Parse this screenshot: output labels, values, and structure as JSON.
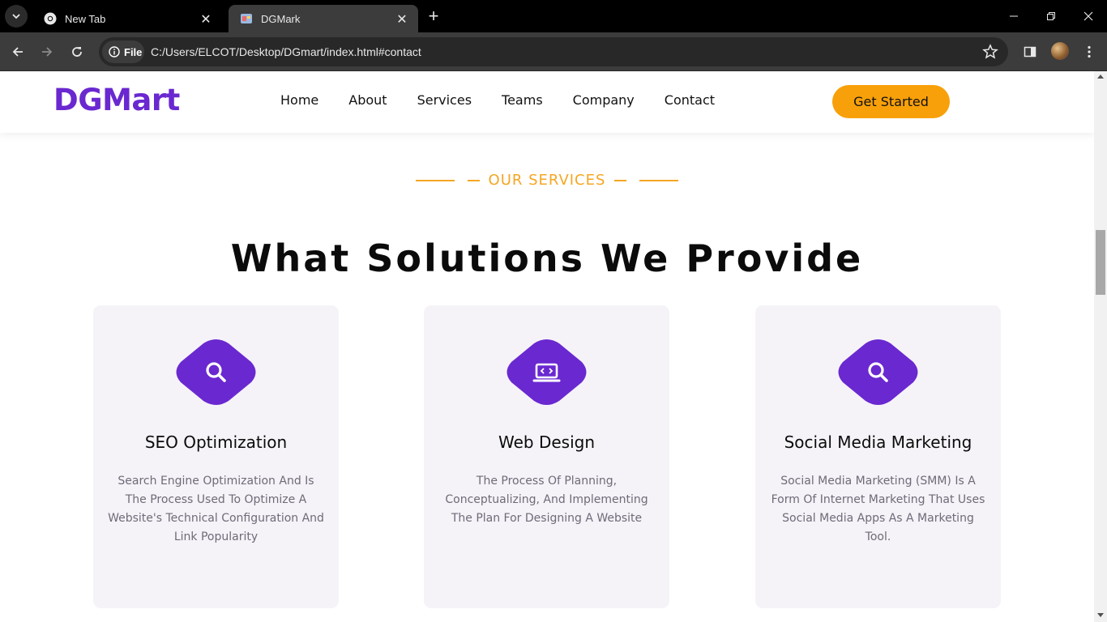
{
  "browser": {
    "tabs": [
      {
        "title": "New Tab",
        "icon": "chrome-icon",
        "active": false
      },
      {
        "title": "DGMark",
        "icon": "page-favicon",
        "active": true
      }
    ],
    "chip_label": "File",
    "url": "C:/Users/ELCOT/Desktop/DGmart/index.html#contact"
  },
  "site": {
    "logo": "DGMart",
    "nav": [
      "Home",
      "About",
      "Services",
      "Teams",
      "Company",
      "Contact"
    ],
    "cta": "Get Started"
  },
  "section": {
    "eyebrow": "OUR SERVICES",
    "heading": "What Solutions We Provide",
    "cards": [
      {
        "icon": "search-icon",
        "title": "SEO Optimization",
        "description": "Search Engine Optimization And Is The Process Used To Optimize A Website's Technical Configuration And Link Popularity"
      },
      {
        "icon": "code-laptop-icon",
        "title": "Web Design",
        "description": "The Process Of Planning, Conceptualizing, And Implementing The Plan For Designing A Website"
      },
      {
        "icon": "search-icon",
        "title": "Social Media Marketing",
        "description": "Social Media Marketing (SMM) Is A Form Of Internet Marketing That Uses Social Media Apps As A Marketing Tool."
      }
    ]
  },
  "colors": {
    "brand_purple": "#6a28d0",
    "accent_orange": "#f8a00a",
    "card_bg": "#f5f3f8"
  }
}
